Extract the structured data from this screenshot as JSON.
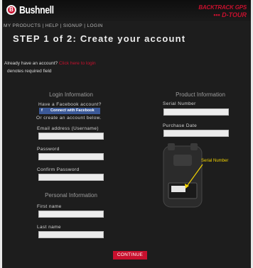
{
  "header": {
    "logo_mark": "B",
    "logo_text": "Bushnell",
    "brand_line1": "BACKTRACK GPS",
    "brand_line2": "••• D-TOUR"
  },
  "nav": [
    "MY PRODUCTS",
    "HELP",
    "SIGNUP",
    "LOGIN"
  ],
  "nav_sep": " | ",
  "page_title": "STEP 1 of 2: Create your account",
  "already": {
    "text": "Already have an account?",
    "link": "Click here to login"
  },
  "required_note": "denotes required field",
  "login": {
    "heading": "Login Information",
    "fb_question": "Have a Facebook account?",
    "fb_button": "Connect with Facebook",
    "fb_icon": "f",
    "or_text": "Or create an account below.",
    "email_label": "Email address (Username)",
    "password_label": "Password",
    "confirm_label": "Confirm Password"
  },
  "personal": {
    "heading": "Personal Information",
    "first_label": "First name",
    "last_label": "Last name"
  },
  "product": {
    "heading": "Product Information",
    "serial_label": "Serial Number",
    "purchase_label": "Purchase Date",
    "image_caption": "Serial Number"
  },
  "continue_label": "CONTINUE",
  "colors": {
    "accent": "#c8102e",
    "facebook": "#3b5998",
    "background": "#1d1d1d"
  }
}
